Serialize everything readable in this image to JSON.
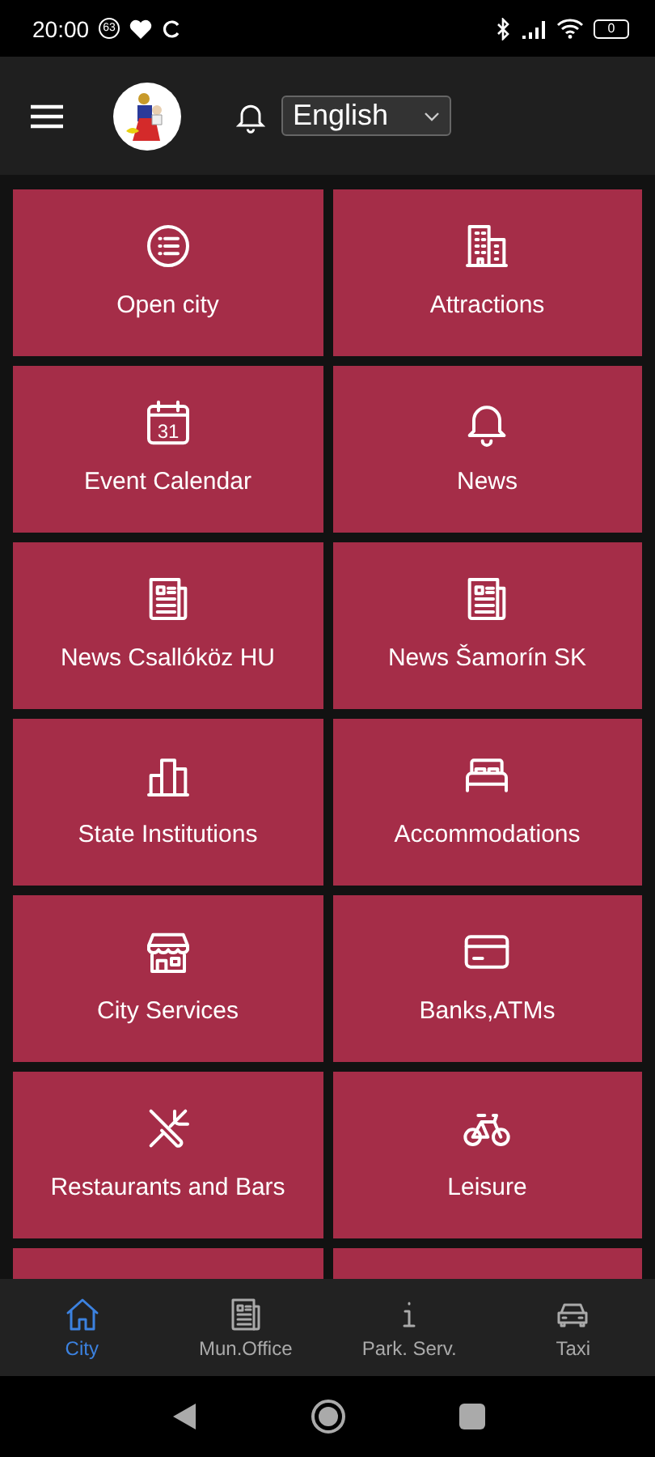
{
  "status_bar": {
    "time": "20:00",
    "badge": "63",
    "battery": "0"
  },
  "header": {
    "language": "English"
  },
  "tiles": [
    {
      "label": "Open city",
      "kind": "list"
    },
    {
      "label": "Attractions",
      "kind": "buildings"
    },
    {
      "label": "Event Calendar",
      "kind": "calendar",
      "icon_text": "31"
    },
    {
      "label": "News",
      "kind": "bell"
    },
    {
      "label": "News Csallóköz HU",
      "kind": "newspaper"
    },
    {
      "label": "News Šamorín SK",
      "kind": "newspaper"
    },
    {
      "label": "State Institutions",
      "kind": "columns"
    },
    {
      "label": "Accommodations",
      "kind": "bed"
    },
    {
      "label": "City Services",
      "kind": "shop"
    },
    {
      "label": "Banks,ATMs",
      "kind": "card"
    },
    {
      "label": "Restaurants and Bars",
      "kind": "utensils"
    },
    {
      "label": "Leisure",
      "kind": "bicycle"
    }
  ],
  "bottom_nav": [
    {
      "label": "City",
      "kind": "home",
      "selected": true
    },
    {
      "label": "Mun.Office",
      "kind": "newspaper",
      "selected": false
    },
    {
      "label": "Park. Serv.",
      "kind": "info",
      "selected": false
    },
    {
      "label": "Taxi",
      "kind": "car",
      "selected": false
    }
  ]
}
